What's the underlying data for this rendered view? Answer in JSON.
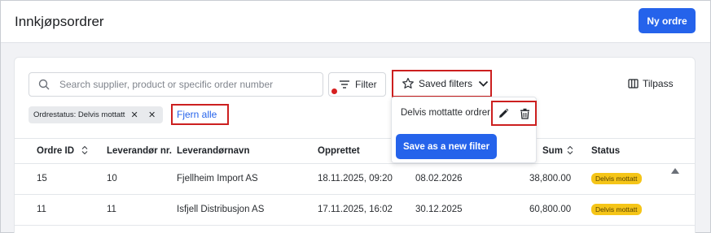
{
  "page": {
    "title": "Innkjøpsordrer",
    "new_order_label": "Ny ordre"
  },
  "toolbar": {
    "search_placeholder": "Search supplier, product or specific order number",
    "filter_label": "Filter",
    "saved_filters_label": "Saved filters",
    "customize_label": "Tilpass"
  },
  "active_filters": {
    "chip_label": "Ordrestatus: Delvis mottatt",
    "clear_all_label": "Fjern alle"
  },
  "saved_filters_menu": {
    "items": [
      {
        "label": "Delvis mottatte ordrer"
      }
    ],
    "save_new_label": "Save as a new filter"
  },
  "table": {
    "columns": [
      "Ordre ID",
      "Leverandør nr.",
      "Leverandørnavn",
      "Opprettet",
      "Sum",
      "Status"
    ],
    "rows": [
      {
        "id": "15",
        "supplier_no": "10",
        "supplier_name": "Fjellheim Import AS",
        "created": "18.11.2025, 09:20",
        "date": "08.02.2026",
        "sum": "38,800.00",
        "status": "Delvis mottatt"
      },
      {
        "id": "11",
        "supplier_no": "11",
        "supplier_name": "Isfjell Distribusjon AS",
        "created": "17.11.2025, 16:02",
        "date": "30.12.2025",
        "sum": "60,800.00",
        "status": "Delvis mottatt"
      }
    ]
  },
  "colors": {
    "accent": "#2563eb",
    "highlight_border": "#cc1f1f",
    "status_badge": "#f5c518"
  },
  "icons": {
    "search": "search-icon",
    "filter": "filter-lines-icon",
    "saved": "star-icon",
    "chevron": "chevron-down-icon",
    "columns": "columns-icon",
    "edit": "pencil-icon",
    "delete": "trash-icon",
    "sort": "sort-icon",
    "scroll": "triangle-up-icon"
  }
}
